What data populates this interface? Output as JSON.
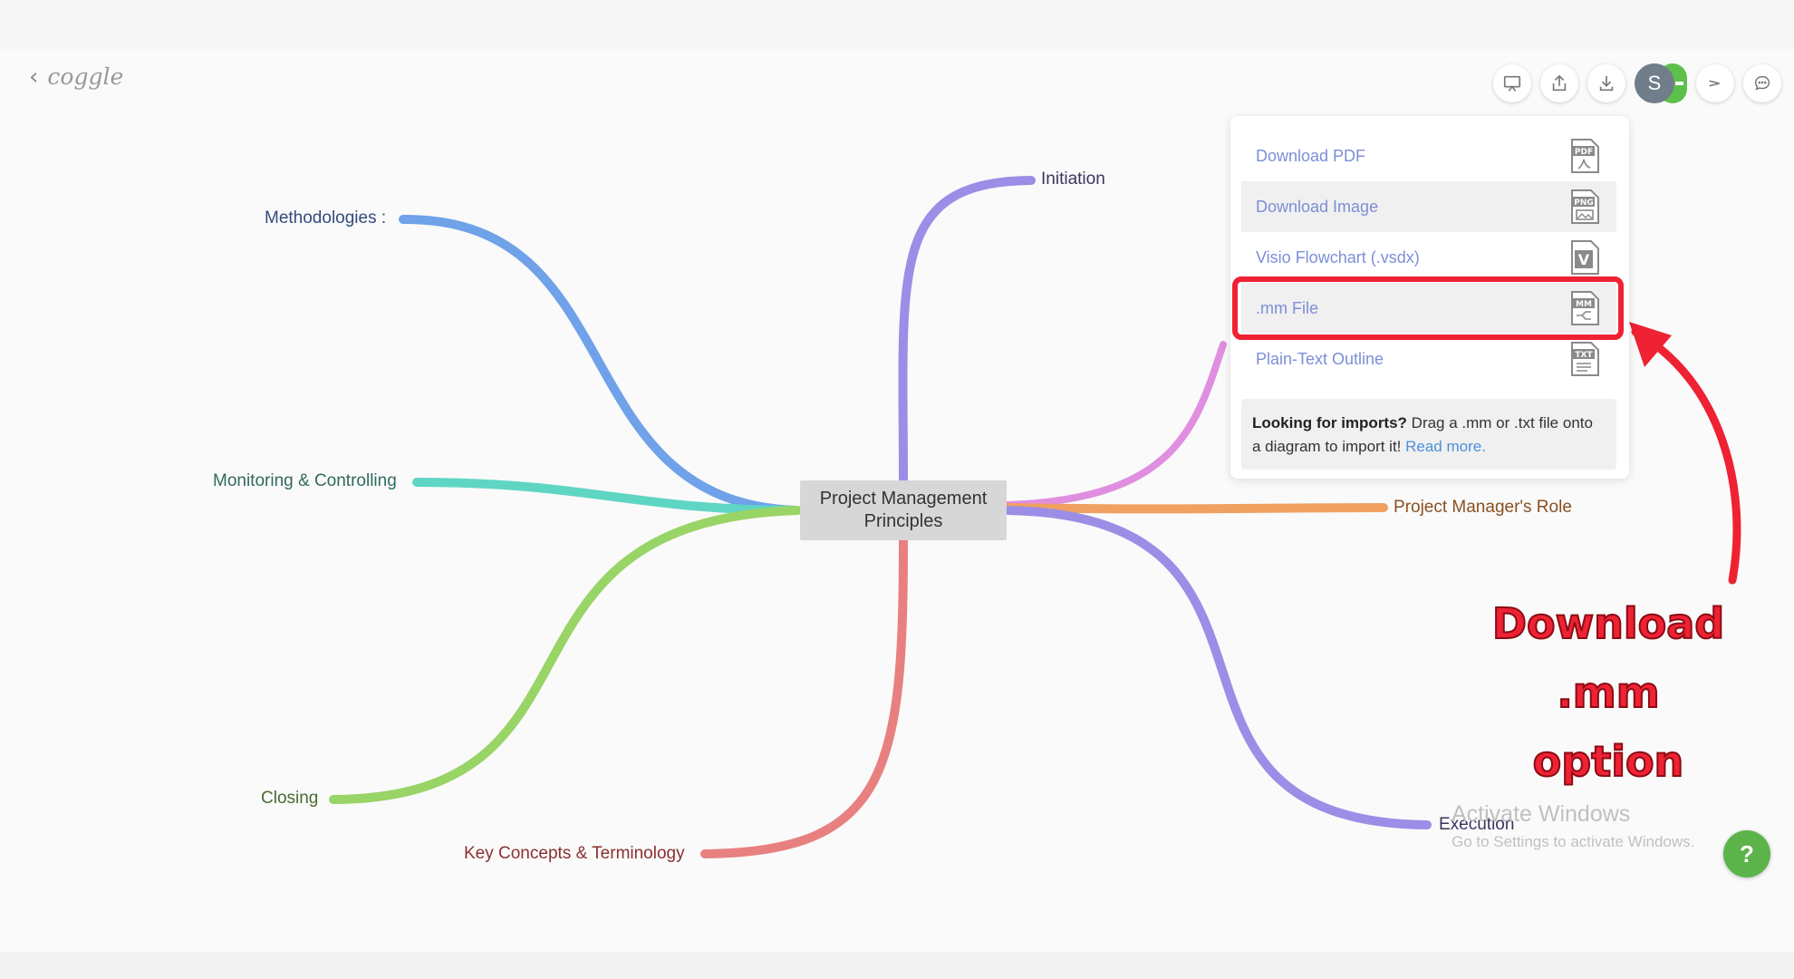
{
  "app": {
    "logo_text": "coggle",
    "back_glyph": "‹"
  },
  "toolbar": {
    "items": [
      {
        "icon": "presentation-icon"
      },
      {
        "icon": "share-upload-icon"
      },
      {
        "icon": "download-icon"
      },
      {
        "icon": "avatar",
        "label": "S"
      },
      {
        "icon": "send-icon"
      },
      {
        "icon": "comment-icon"
      }
    ]
  },
  "mindmap": {
    "center": "Project Management Principles",
    "branches": [
      {
        "label": "Initiation",
        "color": "#9b8ee6"
      },
      {
        "label": "Methodologies :",
        "color": "#6fa2e8"
      },
      {
        "label": "Monitoring & Controlling",
        "color": "#5fd6c4"
      },
      {
        "label": "Closing",
        "color": "#98d466"
      },
      {
        "label": "Key Concepts & Terminology",
        "color": "#e88080"
      },
      {
        "label": "Execution",
        "color": "#9b8ee6"
      },
      {
        "label": "Project Manager's Role",
        "color": "#f0a060"
      },
      {
        "label": "",
        "color": "#e08ee0"
      }
    ]
  },
  "download_menu": {
    "items": [
      {
        "label": "Download PDF",
        "icon": "pdf-file-icon",
        "tag": "PDF"
      },
      {
        "label": "Download Image",
        "icon": "png-file-icon",
        "tag": "PNG"
      },
      {
        "label": "Visio Flowchart (.vsdx)",
        "icon": "visio-file-icon",
        "tag": "V"
      },
      {
        "label": ".mm File",
        "icon": "mm-file-icon",
        "tag": "MM"
      },
      {
        "label": "Plain-Text Outline",
        "icon": "txt-file-icon",
        "tag": "TXT"
      }
    ],
    "imports": {
      "bold": "Looking for imports?",
      "text": " Drag a .mm or .txt file onto a diagram to import it! ",
      "link": "Read more."
    }
  },
  "annotation": {
    "line1": "Download .mm",
    "line2": "option",
    "color": "#ee2233"
  },
  "watermark": {
    "line1": "Activate Windows",
    "line2": "Go to Settings to activate Windows."
  },
  "help": {
    "label": "?"
  }
}
